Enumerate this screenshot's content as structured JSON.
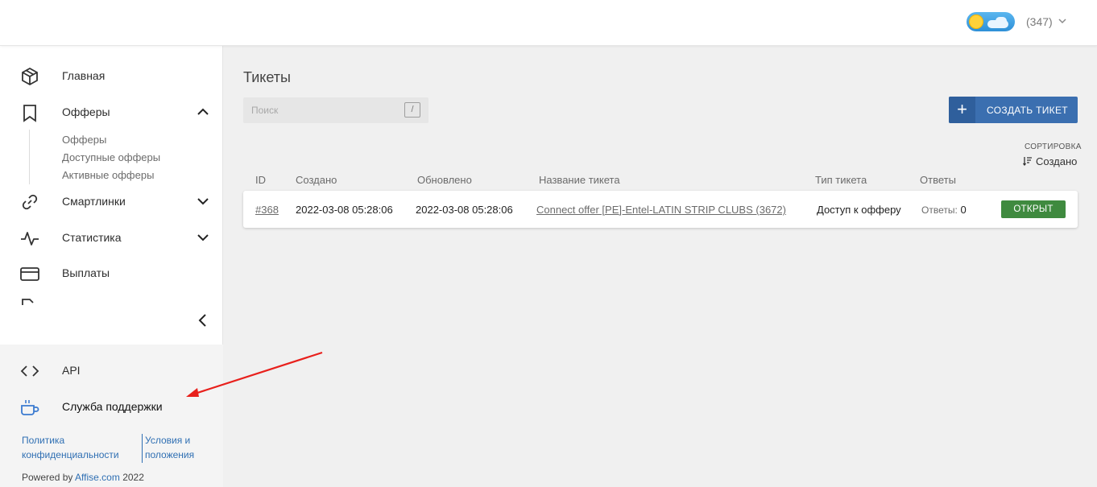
{
  "header": {
    "balance": "(347)"
  },
  "sidebar": {
    "items": [
      {
        "label": "Главная",
        "icon": "package-icon"
      },
      {
        "label": "Офферы",
        "icon": "bookmark-icon",
        "expanded": true
      },
      {
        "label": "Смартлинки",
        "icon": "link-icon",
        "expanded": false
      },
      {
        "label": "Статистика",
        "icon": "pulse-icon",
        "expanded": false
      },
      {
        "label": "Выплаты",
        "icon": "card-icon"
      }
    ],
    "offers_subitems": [
      "Офферы",
      "Доступные офферы",
      "Активные офферы"
    ],
    "bottom": {
      "api_label": "API",
      "support_label": "Служба поддержки",
      "privacy_line1": "Политика",
      "privacy_line2": "конфиденциальности",
      "terms_line1": "Условия и",
      "terms_line2": "положения",
      "powered_prefix": "Powered by",
      "powered_link": "Affise.com",
      "powered_year": "2022"
    }
  },
  "main": {
    "title": "Тикеты",
    "search_placeholder": "Поиск",
    "search_shortcut": "/",
    "create_button": "СОЗДАТЬ ТИКЕТ",
    "sort_label": "СОРТИРОВКА",
    "sort_value": "Создано",
    "columns": [
      "ID",
      "Создано",
      "Обновлено",
      "Название тикета",
      "Тип тикета",
      "Ответы"
    ],
    "rows": [
      {
        "id": "#368",
        "created": "2022-03-08 05:28:06",
        "updated": "2022-03-08 05:28:06",
        "title": "Connect offer [PE]-Entel-LATIN STRIP CLUBS (3672)",
        "type": "Доступ к офферу",
        "answers_label": "Ответы:",
        "answers_count": "0",
        "status": "ОТКРЫТ"
      }
    ]
  },
  "colors": {
    "primary": "#3b6fb0",
    "status_open": "#3f8a3f",
    "link": "#2f6fb3",
    "annotation_arrow": "#e8201c"
  }
}
